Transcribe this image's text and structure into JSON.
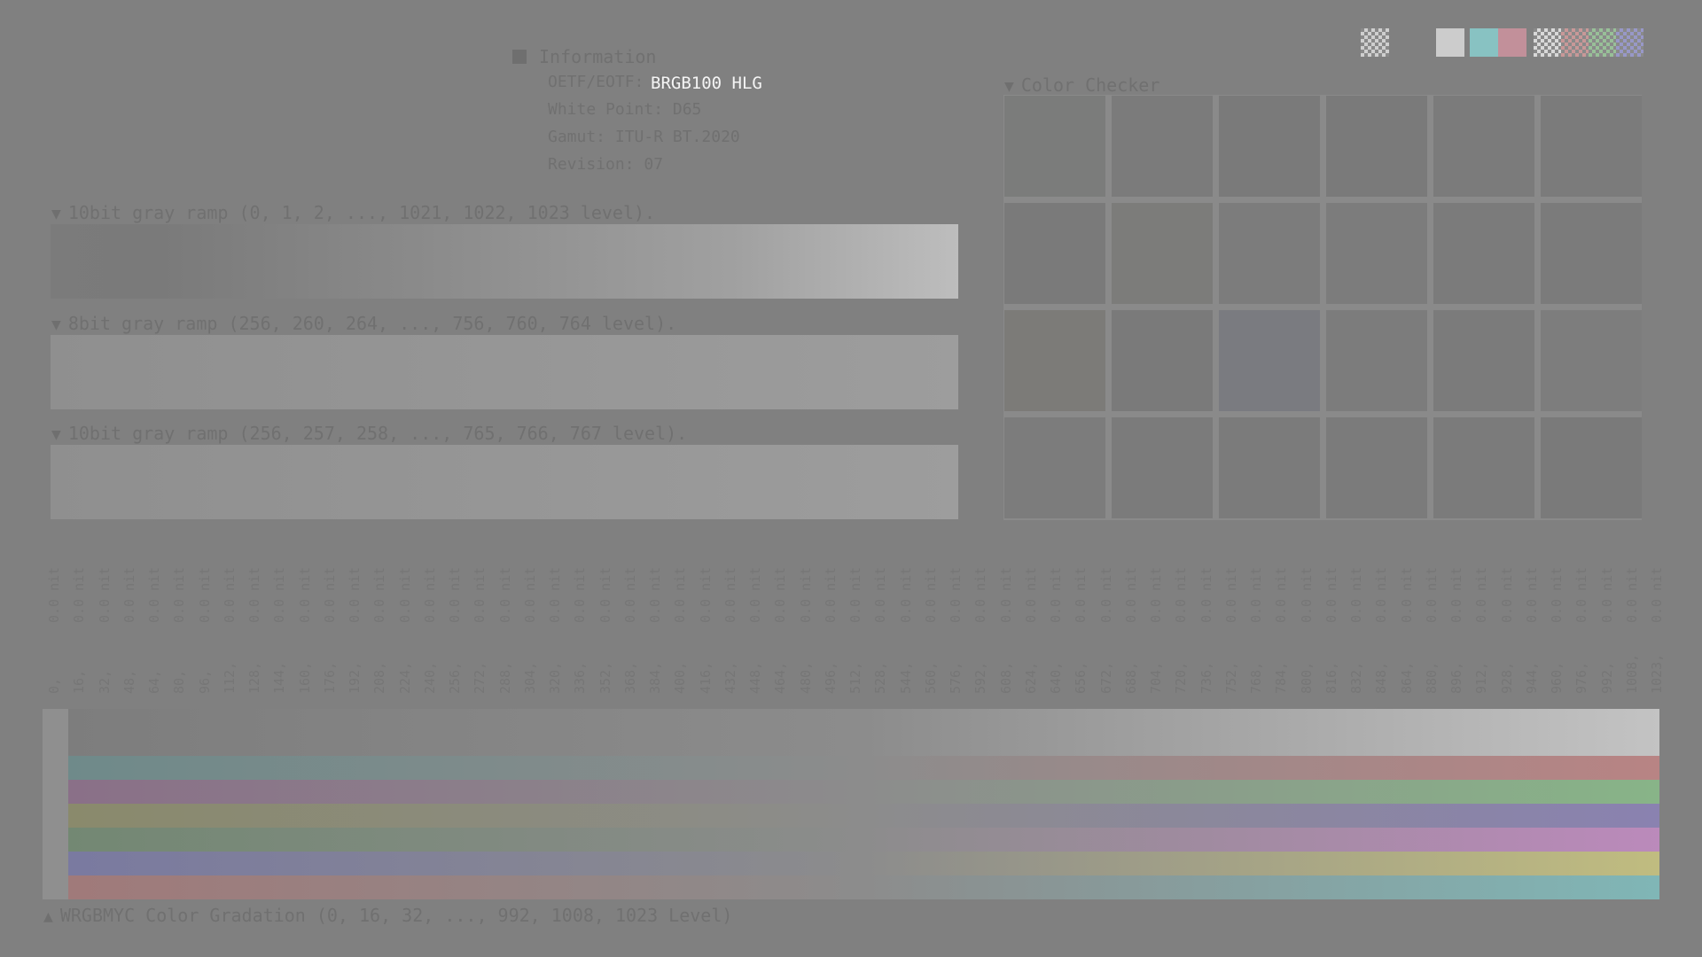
{
  "title": "BRGB100 HLG",
  "information": {
    "heading": "Information",
    "lines": [
      "OETF/EOTF: HLG",
      "White Point: D65",
      "Gamut: ITU-R BT.2020",
      "Revision: 07"
    ]
  },
  "ramps": [
    {
      "label": "10bit gray ramp (0, 1, 2, ..., 1021, 1022, 1023 level)."
    },
    {
      "label": "8bit gray ramp (256, 260, 264, ..., 756, 760, 764 level)."
    },
    {
      "label": "10bit gray ramp (256, 257, 258, ..., 765, 766, 767 level)."
    }
  ],
  "color_checker": {
    "label": "Color Checker",
    "patches": [
      "#7b7c7b",
      "#7b7b7b",
      "#7a7a7a",
      "#7a7a7a",
      "#7b7b7b",
      "#7b7b7b",
      "#7a7a7a",
      "#7c7c7a",
      "#7c7c7c",
      "#7c7c7c",
      "#7b7b7b",
      "#7b7b7b",
      "#7c7b78",
      "#7a7a7a",
      "#7a7b80",
      "#7c7c7c",
      "#7b7b7b",
      "#7d7d7d",
      "#7c7c7c",
      "#7b7b7b",
      "#7b7b7b",
      "#7b7b7b",
      "#7b7b7b",
      "#7a7a7a"
    ]
  },
  "code_values": [
    "0,",
    "16,",
    "32,",
    "48,",
    "64,",
    "80,",
    "96,",
    "112,",
    "128,",
    "144,",
    "160,",
    "176,",
    "192,",
    "208,",
    "224,",
    "240,",
    "256,",
    "272,",
    "288,",
    "304,",
    "320,",
    "336,",
    "352,",
    "368,",
    "384,",
    "400,",
    "416,",
    "432,",
    "448,",
    "464,",
    "480,",
    "496,",
    "512,",
    "528,",
    "544,",
    "560,",
    "576,",
    "592,",
    "608,",
    "624,",
    "640,",
    "656,",
    "672,",
    "688,",
    "704,",
    "720,",
    "736,",
    "752,",
    "768,",
    "784,",
    "800,",
    "816,",
    "832,",
    "848,",
    "864,",
    "880,",
    "896,",
    "912,",
    "928,",
    "944,",
    "960,",
    "976,",
    "992,",
    "1008,",
    "1023,"
  ],
  "nit_label": "0.0 nit",
  "gradation": {
    "label": "WRGBMYC Color Gradation (0, 16, 32, ..., 992, 1008, 1023 Level)",
    "rows": [
      {
        "name": "white",
        "start": "#7d7d7d",
        "end": "#c3c3c3"
      },
      {
        "name": "red",
        "start": "#6f8a8a",
        "end": "#b88484"
      },
      {
        "name": "green",
        "start": "#8a7088",
        "end": "#88b488"
      },
      {
        "name": "blue",
        "start": "#8a8a6c",
        "end": "#8a82b0"
      },
      {
        "name": "magenta",
        "start": "#738873",
        "end": "#bb8abb"
      },
      {
        "name": "yellow",
        "start": "#7a7aa0",
        "end": "#c0bc80"
      },
      {
        "name": "cyan",
        "start": "#a07a7a",
        "end": "#80b6b6"
      }
    ]
  },
  "swatches": [
    {
      "name": "checker-gray",
      "color": "#cfcfcf"
    },
    {
      "name": "solid-gray",
      "color": "#cccccc"
    },
    {
      "name": "solid-cyan",
      "color": "#88c2c2"
    },
    {
      "name": "solid-pink",
      "color": "#c2909a"
    },
    {
      "name": "checker-white",
      "color": "#d8d8d8"
    },
    {
      "name": "checker-pink",
      "color": "#c89898"
    },
    {
      "name": "checker-green",
      "color": "#98c098"
    },
    {
      "name": "checker-blue",
      "color": "#9898c8"
    }
  ]
}
